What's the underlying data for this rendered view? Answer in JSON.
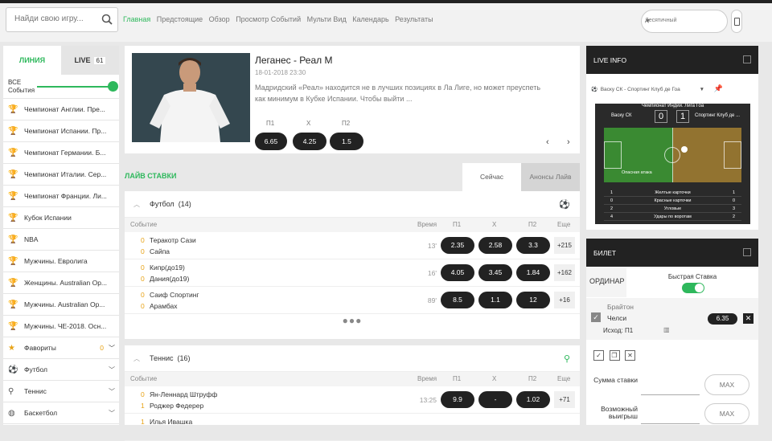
{
  "search": {
    "placeholder": "Найди свою игру..."
  },
  "nav": [
    "Главная",
    "Предстоящие",
    "Обзор",
    "Просмотр Событий",
    "Мульти Вид",
    "Календарь",
    "Результаты"
  ],
  "odds_format": "Десятичный",
  "sidebar": {
    "tab_line": "ЛИНИЯ",
    "tab_live": "LIVE",
    "live_count": "61",
    "all_events": "ВСЕ События",
    "leagues": [
      "Чемпионат Англии. Пре...",
      "Чемпионат Испании. Пр...",
      "Чемпионат Германии. Б...",
      "Чемпионат Италии. Сер...",
      "Чемпионат Франции. Ли...",
      "Кубок Испании",
      "NBA",
      "Мужчины. Евролига",
      "Женщины. Australian Op...",
      "Мужчины. Australian Op...",
      "Мужчины. ЧЕ-2018. Осн..."
    ],
    "favorites": "Фавориты",
    "favorites_count": "0",
    "sports": [
      "Футбол",
      "Теннис",
      "Баскетбол"
    ]
  },
  "featured": {
    "title": "Леганес - Реал М",
    "date": "18-01-2018 23:30",
    "desc": "Мадридский «Реал» находится не в лучших позициях в Ла Лиге, но может преуспеть как минимум в Кубке Испании. Чтобы выйти ...",
    "labels": [
      "П1",
      "X",
      "П2"
    ],
    "odds": [
      "6.65",
      "4.25",
      "1.5"
    ]
  },
  "live_bets": {
    "title": "ЛАЙВ СТАВКИ",
    "tab_now": "Сейчас",
    "tab_ann": "Анонсы Лайв"
  },
  "cols": {
    "event": "Событие",
    "time": "Время",
    "p1": "П1",
    "x": "X",
    "p2": "П2",
    "more": "Еще"
  },
  "football": {
    "name": "Футбол",
    "count": "(14)",
    "matches": [
      {
        "s1": "0",
        "t1": "Теракотр Сази",
        "s2": "0",
        "t2": "Сайпа",
        "time": "13'",
        "o1": "2.35",
        "ox": "2.58",
        "o2": "3.3",
        "more": "+215"
      },
      {
        "s1": "0",
        "t1": "Кипр(до19)",
        "s2": "0",
        "t2": "Дания(до19)",
        "time": "16'",
        "o1": "4.05",
        "ox": "3.45",
        "o2": "1.84",
        "more": "+162"
      },
      {
        "s1": "0",
        "t1": "Саиф Спортинг",
        "s2": "0",
        "t2": "Арамбах",
        "time": "89'",
        "o1": "8.5",
        "ox": "1.1",
        "o2": "12",
        "more": "+16"
      }
    ]
  },
  "tennis": {
    "name": "Теннис",
    "count": "(16)",
    "matches": [
      {
        "s1": "0",
        "t1": "Ян-Леннард Штруфф",
        "s2": "1",
        "t2": "Роджер Федерер",
        "time": "13:25",
        "o1": "9.9",
        "ox": "-",
        "o2": "1.02",
        "more": "+71"
      },
      {
        "s1": "1",
        "t1": "Илья Ивашка",
        "s2": "",
        "t2": "",
        "time": "",
        "o1": "",
        "ox": "",
        "o2": "",
        "more": ""
      }
    ]
  },
  "live_info": {
    "title": "LIVE INFO",
    "match_select": "Васку СК - Спортинг Клуб де Гоа",
    "league": "Чемпионат Индии. Лига Гоа",
    "home": "Васку СК",
    "away": "Спортинг Клуб де ...",
    "score_home": "0",
    "score_away": "1",
    "attack": "Опасная атака",
    "stats": [
      {
        "l": "1",
        "name": "Желтые карточки",
        "r": "1"
      },
      {
        "l": "0",
        "name": "Красные карточки",
        "r": "0"
      },
      {
        "l": "2",
        "name": "Угловые",
        "r": "3"
      },
      {
        "l": "4",
        "name": "Удары по воротам",
        "r": "2"
      }
    ]
  },
  "ticket": {
    "title": "БИЛЕТ",
    "ordinar": "ОРДИНАР",
    "quick": "Быстрая Ставка",
    "bet_match": "Брайтон",
    "bet_team": "Челси",
    "bet_odd": "6.35",
    "bet_outcome": "Исход: П1",
    "sum_label": "Сумма ставки",
    "win_label": "Возможный выигрыш",
    "max": "MAX"
  },
  "colors": {
    "accent": "#2eb85c",
    "dark": "#222222",
    "gold": "#e8a317"
  }
}
